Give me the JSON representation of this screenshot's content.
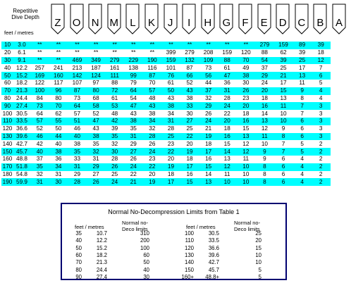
{
  "header": {
    "title_lines": [
      "Repetitive",
      "Dive Depth"
    ],
    "units_label": "feet  /  metres",
    "groups": [
      "Z",
      "O",
      "N",
      "M",
      "L",
      "K",
      "J",
      "I",
      "H",
      "G",
      "F",
      "E",
      "D",
      "C",
      "B",
      "A"
    ]
  },
  "rows": [
    {
      "feet": "10",
      "metres": "3.0",
      "values": [
        "**",
        "**",
        "**",
        "**",
        "**",
        "**",
        "**",
        "**",
        "**",
        "**",
        "**",
        "**",
        "279",
        "159",
        "89",
        "39"
      ]
    },
    {
      "feet": "20",
      "metres": "6.1",
      "values": [
        "**",
        "**",
        "**",
        "**",
        "**",
        "**",
        "**",
        "399",
        "279",
        "208",
        "159",
        "120",
        "88",
        "62",
        "39",
        "18"
      ]
    },
    {
      "feet": "30",
      "metres": "9.1",
      "values": [
        "**",
        "**",
        "469",
        "349",
        "279",
        "229",
        "190",
        "159",
        "132",
        "109",
        "88",
        "70",
        "54",
        "39",
        "25",
        "12"
      ]
    },
    {
      "feet": "40",
      "metres": "12.2",
      "values": [
        "257",
        "241",
        "213",
        "187",
        "161",
        "138",
        "116",
        "101",
        "87",
        "73",
        "61",
        "49",
        "37",
        "25",
        "17",
        "7"
      ]
    },
    {
      "feet": "50",
      "metres": "15.2",
      "values": [
        "169",
        "160",
        "142",
        "124",
        "111",
        "99",
        "87",
        "76",
        "66",
        "56",
        "47",
        "38",
        "29",
        "21",
        "13",
        "6"
      ]
    },
    {
      "feet": "60",
      "metres": "18.2",
      "values": [
        "122",
        "117",
        "107",
        "97",
        "88",
        "79",
        "70",
        "61",
        "52",
        "44",
        "36",
        "30",
        "24",
        "17",
        "11",
        "5"
      ]
    },
    {
      "feet": "70",
      "metres": "21.3",
      "values": [
        "100",
        "96",
        "87",
        "80",
        "72",
        "64",
        "57",
        "50",
        "43",
        "37",
        "31",
        "26",
        "20",
        "15",
        "9",
        "4"
      ]
    },
    {
      "feet": "80",
      "metres": "24.4",
      "values": [
        "84",
        "80",
        "73",
        "68",
        "61",
        "54",
        "48",
        "43",
        "38",
        "32",
        "28",
        "23",
        "18",
        "13",
        "8",
        "4"
      ]
    },
    {
      "feet": "90",
      "metres": "27.4",
      "values": [
        "73",
        "70",
        "64",
        "58",
        "53",
        "47",
        "43",
        "38",
        "33",
        "29",
        "24",
        "20",
        "16",
        "11",
        "7",
        "3"
      ]
    },
    {
      "feet": "100",
      "metres": "30.5",
      "values": [
        "64",
        "62",
        "57",
        "52",
        "48",
        "43",
        "38",
        "34",
        "30",
        "26",
        "22",
        "18",
        "14",
        "10",
        "7",
        "3"
      ]
    },
    {
      "feet": "110",
      "metres": "33.5",
      "values": [
        "57",
        "55",
        "51",
        "47",
        "42",
        "38",
        "34",
        "31",
        "27",
        "24",
        "20",
        "16",
        "13",
        "10",
        "6",
        "3"
      ]
    },
    {
      "feet": "120",
      "metres": "36.6",
      "values": [
        "52",
        "50",
        "46",
        "43",
        "39",
        "35",
        "32",
        "28",
        "25",
        "21",
        "18",
        "15",
        "12",
        "9",
        "6",
        "3"
      ]
    },
    {
      "feet": "130",
      "metres": "39.6",
      "values": [
        "46",
        "44",
        "40",
        "38",
        "35",
        "31",
        "28",
        "25",
        "22",
        "19",
        "16",
        "13",
        "11",
        "8",
        "6",
        "3"
      ]
    },
    {
      "feet": "140",
      "metres": "42.7",
      "values": [
        "42",
        "40",
        "38",
        "35",
        "32",
        "29",
        "26",
        "23",
        "20",
        "18",
        "15",
        "12",
        "10",
        "7",
        "5",
        "2"
      ]
    },
    {
      "feet": "150",
      "metres": "45.7",
      "values": [
        "40",
        "38",
        "35",
        "32",
        "30",
        "27",
        "24",
        "22",
        "19",
        "17",
        "14",
        "12",
        "9",
        "7",
        "5",
        "2"
      ]
    },
    {
      "feet": "160",
      "metres": "48.8",
      "values": [
        "37",
        "36",
        "33",
        "31",
        "28",
        "26",
        "23",
        "20",
        "18",
        "16",
        "13",
        "11",
        "9",
        "6",
        "4",
        "2"
      ]
    },
    {
      "feet": "170",
      "metres": "51.8",
      "values": [
        "35",
        "34",
        "31",
        "29",
        "26",
        "24",
        "22",
        "19",
        "17",
        "15",
        "12",
        "10",
        "8",
        "6",
        "4",
        "2"
      ]
    },
    {
      "feet": "180",
      "metres": "54.8",
      "values": [
        "32",
        "31",
        "29",
        "27",
        "25",
        "22",
        "20",
        "18",
        "16",
        "14",
        "11",
        "10",
        "8",
        "6",
        "4",
        "2"
      ]
    },
    {
      "feet": "190",
      "metres": "59.9",
      "values": [
        "31",
        "30",
        "28",
        "26",
        "24",
        "21",
        "19",
        "17",
        "15",
        "13",
        "10",
        "10",
        "8",
        "6",
        "4",
        "2"
      ]
    }
  ],
  "summary": {
    "title": "Normal No-Decompression Limits from Table 1",
    "units_label": "feet  /  metres",
    "limits_label_lines": [
      "Normal no-",
      "Deco limits"
    ],
    "left": [
      {
        "feet": "35",
        "metres": "10.7",
        "limit": "310"
      },
      {
        "feet": "40",
        "metres": "12.2",
        "limit": "200"
      },
      {
        "feet": "50",
        "metres": "15.2",
        "limit": "100"
      },
      {
        "feet": "60",
        "metres": "18.2",
        "limit": "60"
      },
      {
        "feet": "70",
        "metres": "21.3",
        "limit": "50"
      },
      {
        "feet": "80",
        "metres": "24.4",
        "limit": "40"
      },
      {
        "feet": "90",
        "metres": "27.4",
        "limit": "30"
      }
    ],
    "right": [
      {
        "feet": "100",
        "metres": "30.5",
        "limit": "25"
      },
      {
        "feet": "110",
        "metres": "33.5",
        "limit": "20"
      },
      {
        "feet": "120",
        "metres": "36.6",
        "limit": "15"
      },
      {
        "feet": "130",
        "metres": "39.6",
        "limit": "10"
      },
      {
        "feet": "140",
        "metres": "42.7",
        "limit": "10"
      },
      {
        "feet": "150",
        "metres": "45.7",
        "limit": "5"
      },
      {
        "feet": "160+",
        "metres": "48.8+",
        "limit": "5"
      }
    ]
  },
  "colors": {
    "row_highlight": "#00ffff",
    "frame": "#000070"
  }
}
